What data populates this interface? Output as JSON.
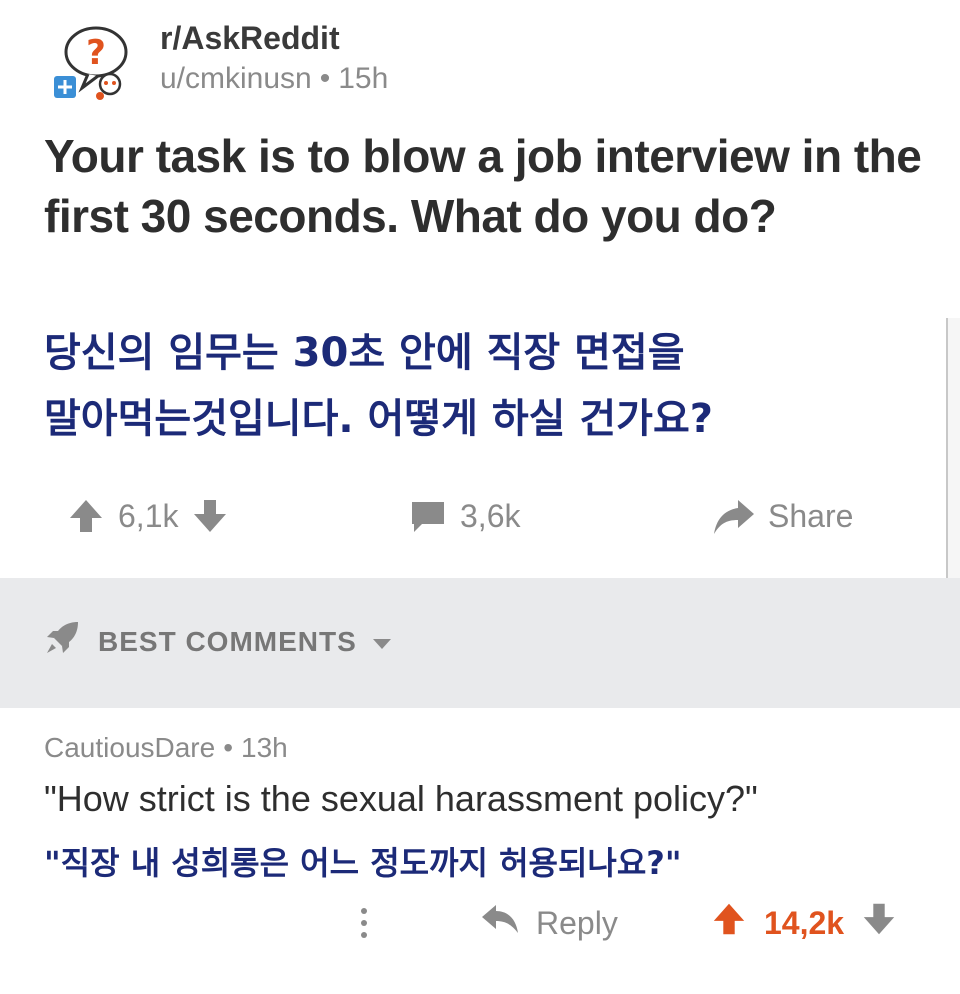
{
  "post": {
    "subreddit": "r/AskReddit",
    "author": "u/cmkinusn",
    "separator": "•",
    "age": "15h",
    "title_en": "Your task is to blow a job interview in the first 30 seconds. What do you do?",
    "title_ko_line1": "당신의 임무는 30초 안에 직장 면접을",
    "title_ko_line2": "말아먹는것입니다. 어떻게 하실 건가요?",
    "upvotes": "6,1k",
    "comments": "3,6k",
    "share_label": "Share"
  },
  "section": {
    "label": "BEST COMMENTS"
  },
  "comment": {
    "author": "CautiousDare",
    "separator": "•",
    "age": "13h",
    "text_en": "\"How strict is the sexual harassment policy?\"",
    "text_ko": "\"직장 내 성희롱은 어느 정도까지 허용되나요?\"",
    "reply_label": "Reply",
    "score": "14,2k"
  },
  "colors": {
    "korean_text": "#1c2a78",
    "upvoted": "#e0531e",
    "muted": "#8a8a8a",
    "band": "#e9eaec"
  },
  "icons": [
    "askreddit-avatar-icon",
    "upvote-icon",
    "downvote-icon",
    "comment-bubble-icon",
    "share-arrow-icon",
    "rocket-icon",
    "chevron-down-icon",
    "more-options-icon",
    "reply-arrow-icon"
  ]
}
